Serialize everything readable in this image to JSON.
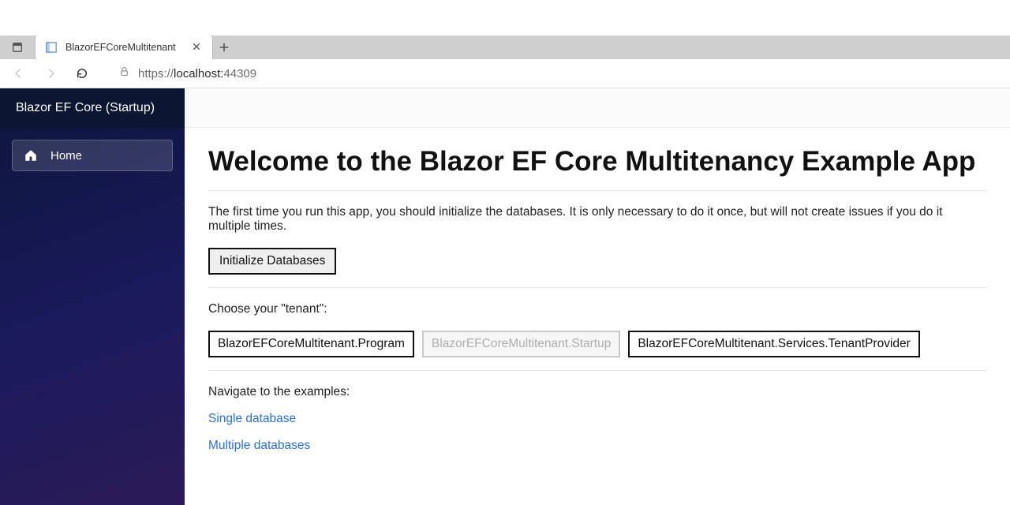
{
  "browser": {
    "tab_title": "BlazorEFCoreMultitenant",
    "url_prefix": "https://",
    "url_host": "localhost:",
    "url_port": "44309"
  },
  "sidebar": {
    "brand": "Blazor EF Core (Startup)",
    "items": [
      {
        "label": "Home",
        "icon": "home-icon"
      }
    ]
  },
  "main": {
    "heading": "Welcome to the Blazor EF Core Multitenancy Example App",
    "intro": "The first time you run this app, you should initialize the databases. It is only necessary to do it once, but will not create issues if you do it multiple times.",
    "init_button": "Initialize Databases",
    "choose_label": "Choose your \"tenant\":",
    "tenants": [
      {
        "label": "BlazorEFCoreMultitenant.Program",
        "disabled": false
      },
      {
        "label": "BlazorEFCoreMultitenant.Startup",
        "disabled": true
      },
      {
        "label": "BlazorEFCoreMultitenant.Services.TenantProvider",
        "disabled": false
      }
    ],
    "navigate_label": "Navigate to the examples:",
    "links": [
      {
        "label": "Single database"
      },
      {
        "label": "Multiple databases"
      }
    ]
  }
}
